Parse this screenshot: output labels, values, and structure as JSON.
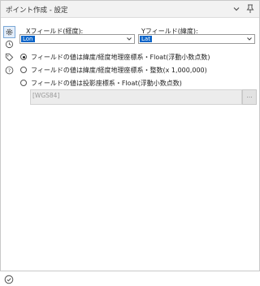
{
  "window": {
    "title": "ポイント作成 - 設定",
    "chevron_icon": "chevron-down-icon",
    "pin_icon": "pin-icon"
  },
  "sidebar": {
    "items": [
      {
        "icon": "gear-icon",
        "active": true
      },
      {
        "icon": "cycle-icon"
      },
      {
        "icon": "tag-icon"
      },
      {
        "icon": "help-icon"
      }
    ],
    "bottom_icon": "check-circle-icon"
  },
  "fields": {
    "x_label": "Xフィールド(経度):",
    "x_value": "Lon",
    "y_label": "Yフィールド(緯度):",
    "y_value": "Lat"
  },
  "options": [
    {
      "label": "フィールドの値は緯度/経度地理座標系・Float(浮動小数点数)",
      "selected": true
    },
    {
      "label": "フィールドの値は緯度/経度地理座標系・整数(x 1,000,000)",
      "selected": false
    },
    {
      "label": "フィールドの値は投影座標系・Float(浮動小数点数)",
      "selected": false
    }
  ],
  "coordinate_system": {
    "value": "[WGS84]",
    "browse_label": "..."
  },
  "colors": {
    "accent": "#0a64c8",
    "active_bg": "#e4eefa",
    "active_border": "#7aa7d6"
  }
}
